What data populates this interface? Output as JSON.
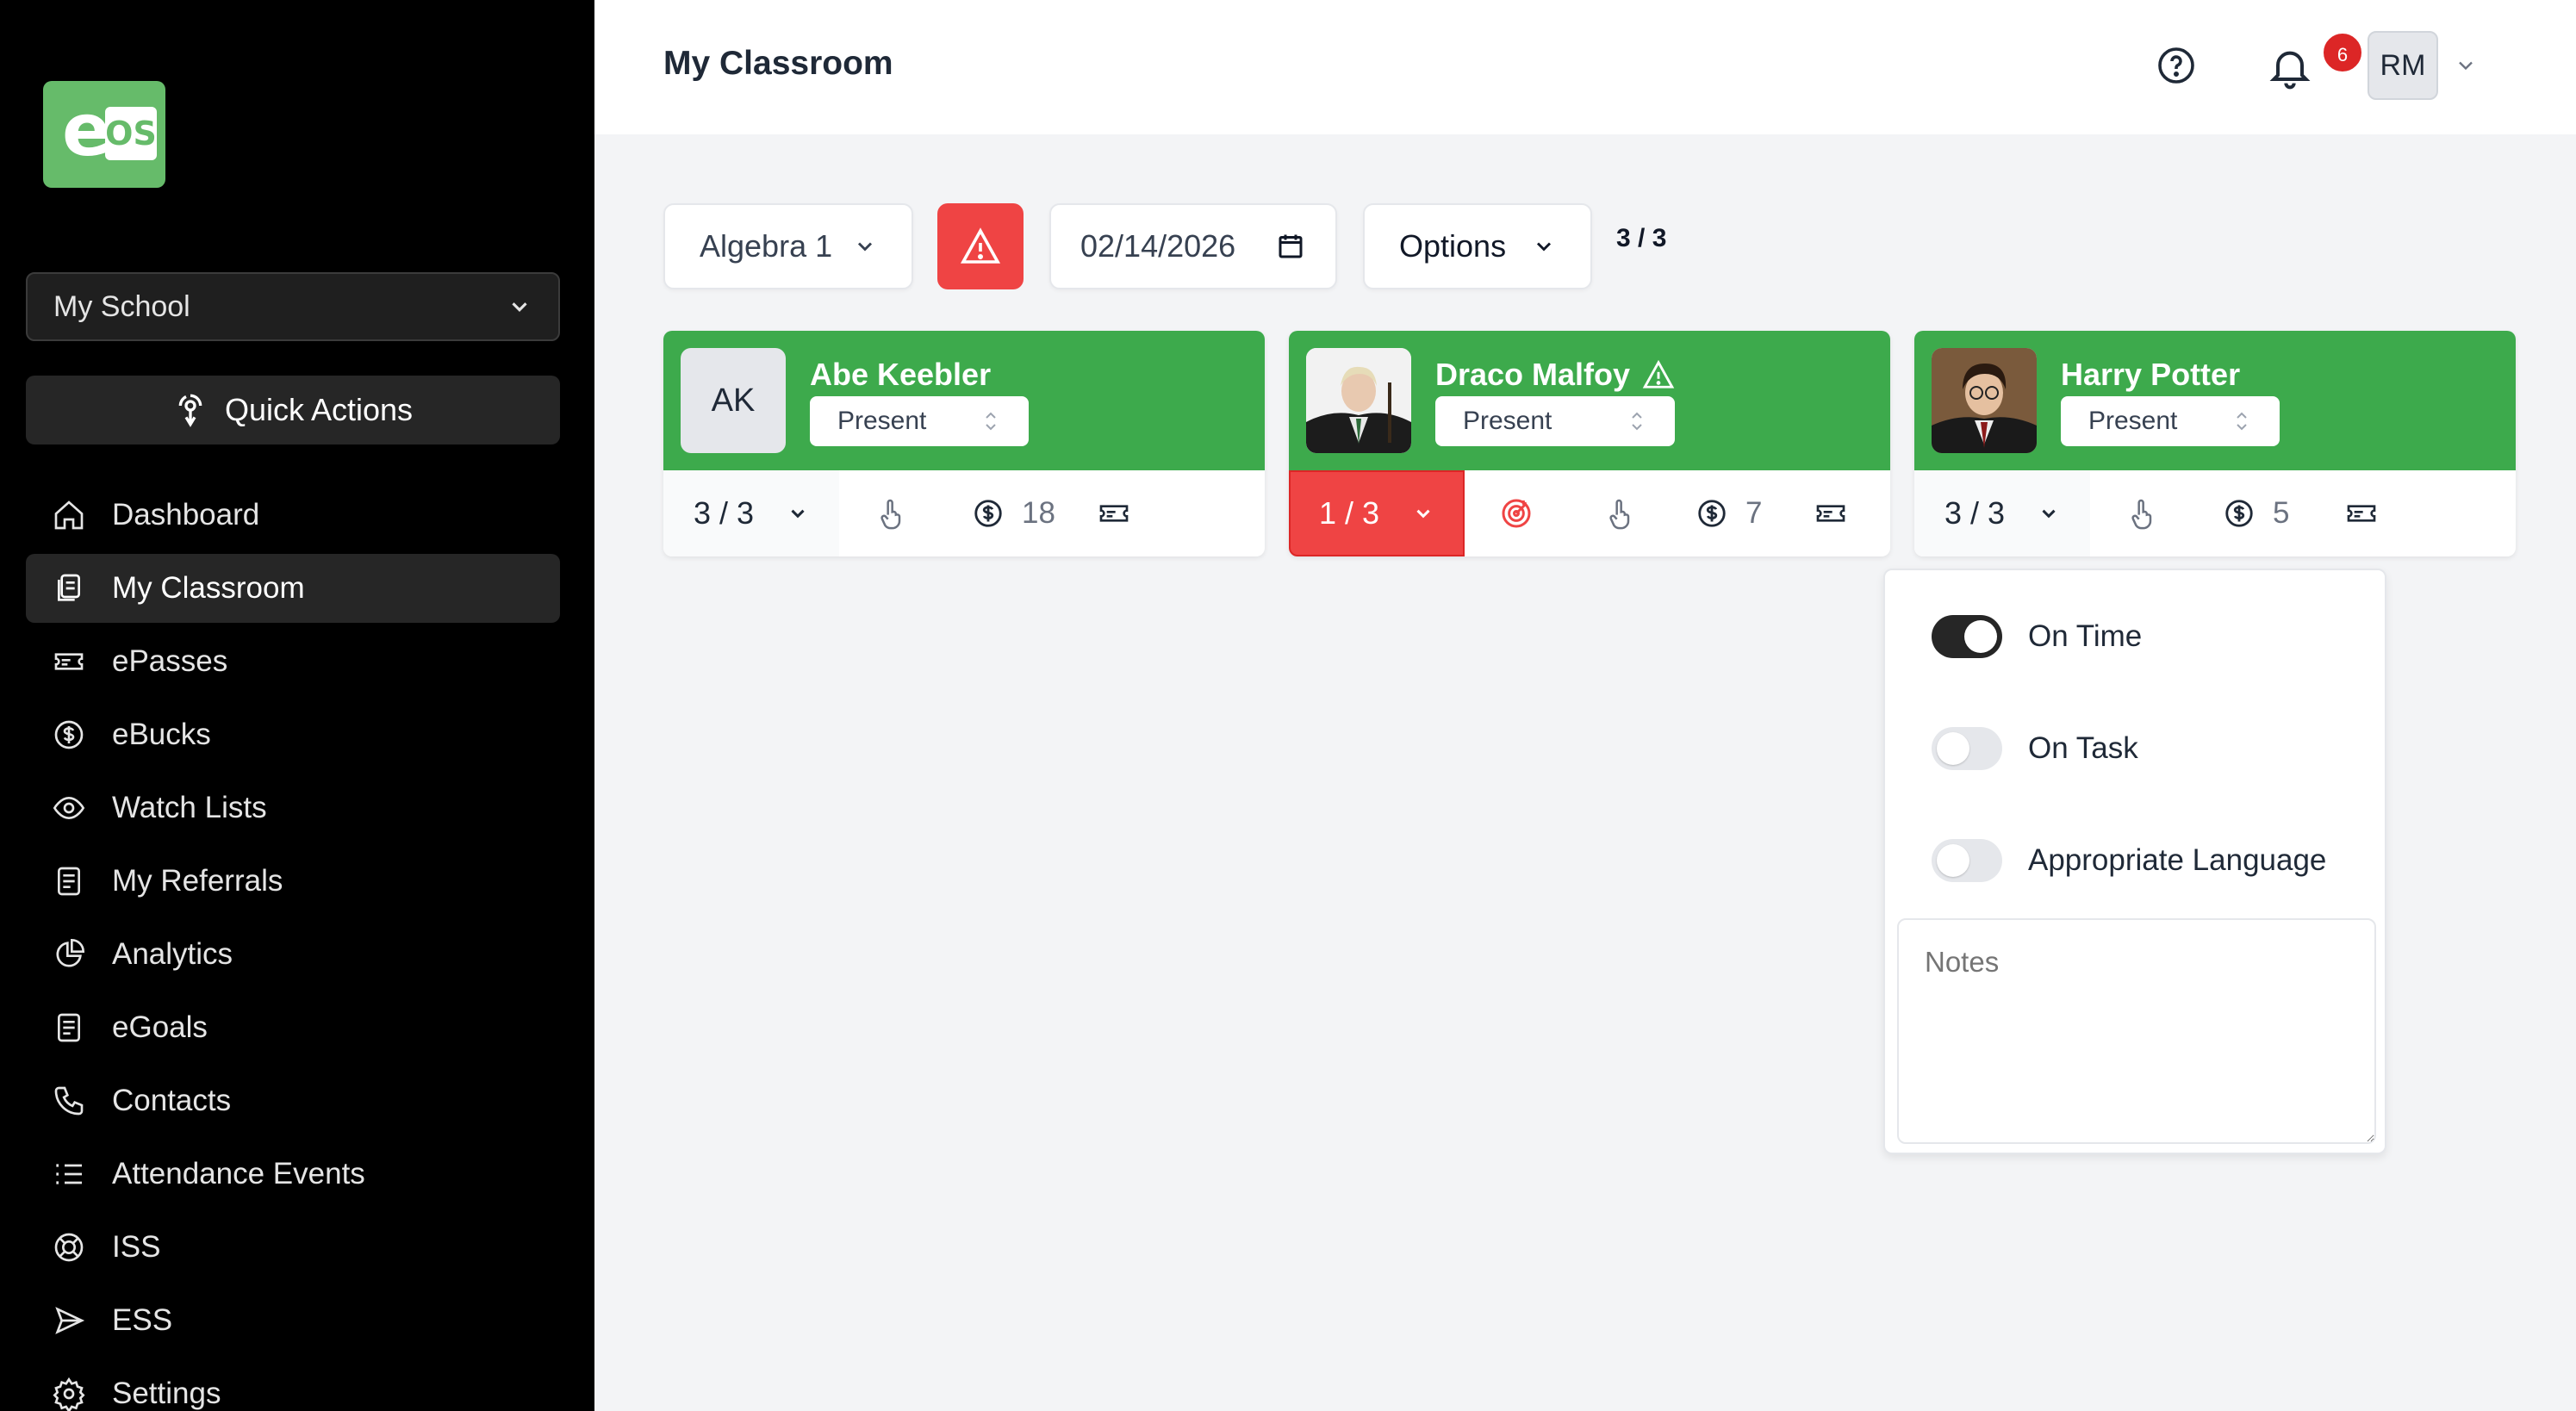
{
  "logo": {
    "e": "e",
    "os": "OS"
  },
  "sidebar": {
    "school_select": "My School",
    "quick_actions": "Quick Actions",
    "items": [
      {
        "label": "Dashboard",
        "icon": "home-icon"
      },
      {
        "label": "My Classroom",
        "icon": "classroom-icon",
        "active": true
      },
      {
        "label": "ePasses",
        "icon": "ticket-icon"
      },
      {
        "label": "eBucks",
        "icon": "dollar-icon"
      },
      {
        "label": "Watch Lists",
        "icon": "eye-icon"
      },
      {
        "label": "My Referrals",
        "icon": "document-icon"
      },
      {
        "label": "Analytics",
        "icon": "pie-chart-icon"
      },
      {
        "label": "eGoals",
        "icon": "document-icon"
      },
      {
        "label": "Contacts",
        "icon": "phone-icon"
      },
      {
        "label": "Attendance Events",
        "icon": "list-icon"
      },
      {
        "label": "ISS",
        "icon": "lifebuoy-icon"
      },
      {
        "label": "ESS",
        "icon": "send-icon"
      },
      {
        "label": "Settings",
        "icon": "gear-icon"
      }
    ]
  },
  "header": {
    "title": "My Classroom",
    "notification_count": "6",
    "user_initials": "RM"
  },
  "toolbar": {
    "class_select": "Algebra 1",
    "date_value": "02/14/2026",
    "options_label": "Options",
    "count": "3 / 3"
  },
  "students": [
    {
      "name": "Abe Keebler",
      "initials": "AK",
      "attendance": "Present",
      "score": "3 / 3",
      "bucks": "18",
      "warning": false
    },
    {
      "name": "Draco Malfoy",
      "initials": "",
      "attendance": "Present",
      "score": "1 / 3",
      "bucks": "7",
      "warning": true
    },
    {
      "name": "Harry Potter",
      "initials": "",
      "attendance": "Present",
      "score": "3 / 3",
      "bucks": "5",
      "warning": false
    }
  ],
  "behavior_popup": {
    "toggles": [
      {
        "label": "On Time",
        "on": true
      },
      {
        "label": "On Task",
        "on": false
      },
      {
        "label": "Appropriate Language",
        "on": false
      }
    ],
    "notes_placeholder": "Notes"
  },
  "colors": {
    "card_green": "#3daa4c",
    "alert_red": "#ef4444",
    "sidebar_bg": "#000000",
    "logo_green": "#66bb6a"
  }
}
